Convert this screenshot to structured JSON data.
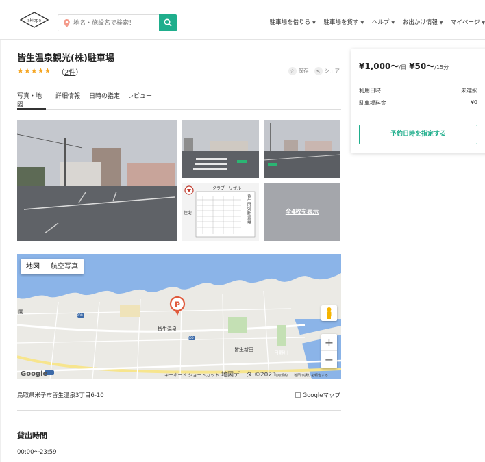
{
  "header": {
    "logo_text": "akippa",
    "search_placeholder": "地名・施設名で検索！",
    "nav": [
      {
        "label": "駐車場を借りる"
      },
      {
        "label": "駐車場を貸す"
      },
      {
        "label": "ヘルプ"
      },
      {
        "label": "お出かけ情報"
      },
      {
        "label": "マイページ"
      }
    ],
    "brand_color": "#1fae8c"
  },
  "listing": {
    "title": "皆生温泉観光(株)駐車場",
    "stars": "★★★★★",
    "rating": 5,
    "review_open": "（",
    "review_count": "2件",
    "review_close": "）",
    "save_label": "保存",
    "share_label": "シェア"
  },
  "tabs": [
    {
      "label": "写真・地図"
    },
    {
      "label": "詳細情報"
    },
    {
      "label": "日時の指定"
    },
    {
      "label": "レビュー"
    }
  ],
  "photos": {
    "more_label": "全4枚を表示",
    "sign_header": "クラブ　リザル",
    "sign_side": "住宅",
    "sign_vertical": "皆生内別駐車場"
  },
  "map": {
    "toggle_map": "地図",
    "toggle_aerial": "航空写真",
    "place_label": "皆生温泉",
    "place_label_2": "皆生新田",
    "river_label": "日野川",
    "edge_label": "開",
    "road_marker": "300",
    "footer_shortcuts": "キーボード ショートカット",
    "footer_data": "地図データ ©2023",
    "footer_scale": "利用規約",
    "footer_report": "地図の誤りを報告する",
    "google_text": "Google",
    "zoom_in": "+",
    "zoom_out": "−"
  },
  "address": "鳥取県米子市皆生温泉3丁目6-10",
  "google_maps_link": "Googleマップ",
  "section_title": "貸出時間",
  "hours": "00:00〜23:59",
  "card": {
    "price_day": "¥1,000〜",
    "per_day": "/日",
    "price_15": "¥50〜",
    "per_15": "/15分",
    "date_label": "利用日時",
    "date_value": "未選択",
    "fee_label": "駐車場料金",
    "fee_value": "¥0",
    "button": "予約日時を指定する"
  }
}
